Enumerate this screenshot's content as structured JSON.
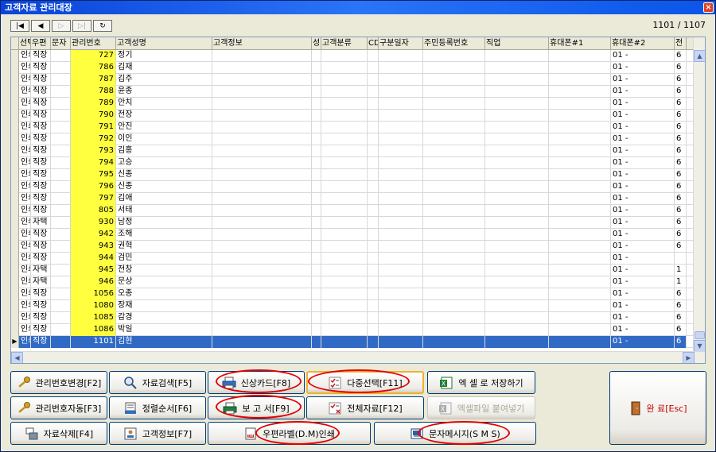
{
  "window": {
    "title": "고객자료 관리대장",
    "close": "×"
  },
  "nav": {
    "first": "|◀",
    "prev": "◀",
    "next": "▷",
    "last": "▷|",
    "refresh": "↻"
  },
  "record_count": "1101 / 1107",
  "columns": [
    "선택",
    "우편",
    "문자",
    "관리번호",
    "고객성명",
    "고객정보",
    "성",
    "고객분류",
    "CD",
    "구분일자",
    "주민등록번호",
    "직업",
    "휴대폰#1",
    "휴대폰#2",
    "전"
  ],
  "rows": [
    [
      "인쇄",
      "직장",
      "",
      "727",
      "정기",
      "01 -",
      "6"
    ],
    [
      "인쇄",
      "직장",
      "",
      "786",
      "김재",
      "01 -",
      "6"
    ],
    [
      "인쇄",
      "직장",
      "",
      "787",
      "김주",
      "01 -",
      "6"
    ],
    [
      "인쇄",
      "직장",
      "",
      "788",
      "윤종",
      "01 -",
      "6"
    ],
    [
      "인쇄",
      "직장",
      "",
      "789",
      "안치",
      "01 -",
      "6"
    ],
    [
      "인쇄",
      "직장",
      "",
      "790",
      "전장",
      "01 -",
      "6"
    ],
    [
      "인쇄",
      "직장",
      "",
      "791",
      "안진",
      "01 -",
      "6"
    ],
    [
      "인쇄",
      "직장",
      "",
      "792",
      "이인",
      "01 -",
      "6"
    ],
    [
      "인쇄",
      "직장",
      "",
      "793",
      "김홍",
      "01 -",
      "6"
    ],
    [
      "인쇄",
      "직장",
      "",
      "794",
      "고승",
      "01 -",
      "6"
    ],
    [
      "인쇄",
      "직장",
      "",
      "795",
      "신종",
      "01 -",
      "6"
    ],
    [
      "인쇄",
      "직장",
      "",
      "796",
      "신종",
      "01 -",
      "6"
    ],
    [
      "인쇄",
      "직장",
      "",
      "797",
      "김애",
      "01 -",
      "6"
    ],
    [
      "인쇄",
      "직장",
      "",
      "805",
      "서태",
      "01 -",
      "6"
    ],
    [
      "인쇄",
      "자택",
      "",
      "930",
      "남정",
      "01 -",
      "6"
    ],
    [
      "인쇄",
      "직장",
      "",
      "942",
      "조해",
      "01 -",
      "6"
    ],
    [
      "인쇄",
      "직장",
      "",
      "943",
      "권혁",
      "01 -",
      "6"
    ],
    [
      "인쇄",
      "직장",
      "",
      "944",
      "검민",
      "01 -",
      ""
    ],
    [
      "인쇄",
      "자택",
      "",
      "945",
      "전창",
      "01 -",
      "1"
    ],
    [
      "인쇄",
      "자택",
      "",
      "946",
      "문상",
      "01 -",
      "1"
    ],
    [
      "인쇄",
      "직장",
      "",
      "1056",
      "오종",
      "01 -",
      "6"
    ],
    [
      "인쇄",
      "직장",
      "",
      "1080",
      "장재",
      "01 -",
      "6"
    ],
    [
      "인쇄",
      "직장",
      "",
      "1085",
      "감경",
      "01 -",
      "6"
    ],
    [
      "인쇄",
      "직장",
      "",
      "1086",
      "박일",
      "01 -",
      "6"
    ],
    [
      "인쇄",
      "직장",
      "",
      "1101",
      "김현",
      "01 -",
      "6"
    ]
  ],
  "buttons": {
    "change_no": "관리번호변경[F2]",
    "search": "자료검색[F5]",
    "card": "신상카드[F8]",
    "multi": "다중선택[F11]",
    "excel_save": "엑 셀 로 저장하기",
    "auto_no": "관리번호자동[F3]",
    "sort": "정렬순서[F6]",
    "report": "보 고 서[F9]",
    "all": "전체자료[F12]",
    "excel_paste": "엑셀파일 붙여넣기",
    "delete": "자료삭제[F4]",
    "info": "고객정보[F7]",
    "label": "우편라벨(D.M)인쇄",
    "sms": "문자메시지(S M S)",
    "done": "완 료[Esc]"
  }
}
